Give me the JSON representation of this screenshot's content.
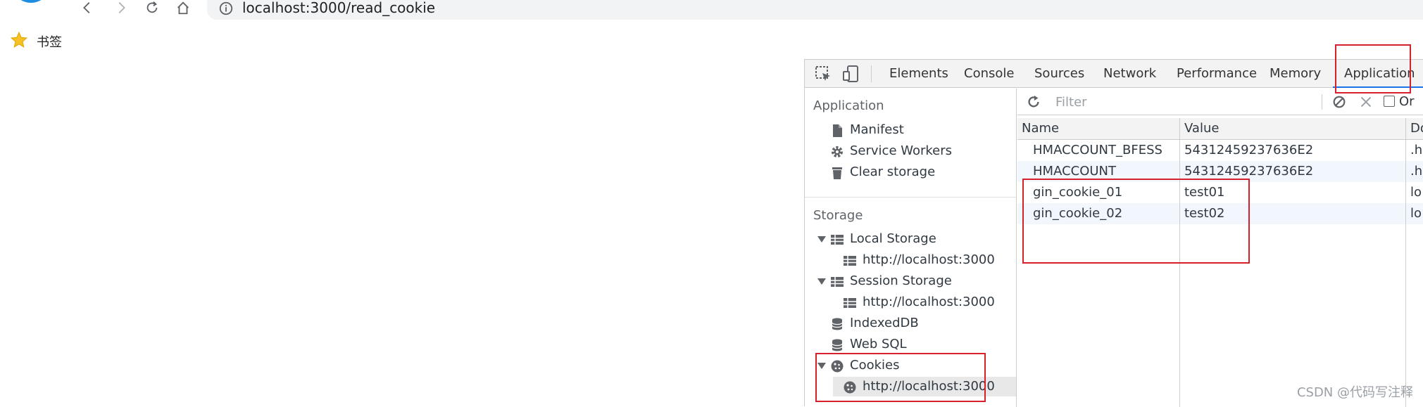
{
  "browser": {
    "url": "localhost:3000/read_cookie",
    "bookmark_label": "书签"
  },
  "devtools": {
    "tabs": [
      "Elements",
      "Console",
      "Sources",
      "Network",
      "Performance",
      "Memory",
      "Application"
    ],
    "active_tab": "Application",
    "sidebar": {
      "application_title": "Application",
      "application_items": [
        "Manifest",
        "Service Workers",
        "Clear storage"
      ],
      "storage_title": "Storage",
      "local_storage": {
        "label": "Local Storage",
        "child": "http://localhost:3000"
      },
      "session_storage": {
        "label": "Session Storage",
        "child": "http://localhost:3000"
      },
      "indexeddb": "IndexedDB",
      "websql": "Web SQL",
      "cookies": {
        "label": "Cookies",
        "child": "http://localhost:3000"
      }
    },
    "filter": {
      "placeholder": "Filter",
      "checkbox_label": "Or"
    },
    "table": {
      "columns": [
        "Name",
        "Value",
        "Do"
      ],
      "rows": [
        {
          "name": "HMACCOUNT_BFESS",
          "value": "54312459237636E2",
          "domain": ".h"
        },
        {
          "name": "HMACCOUNT",
          "value": "54312459237636E2",
          "domain": ".h"
        },
        {
          "name": "gin_cookie_01",
          "value": "test01",
          "domain": "lo"
        },
        {
          "name": "gin_cookie_02",
          "value": "test02",
          "domain": "lo"
        }
      ]
    }
  },
  "watermark": "CSDN @代码写注释",
  "colors": {
    "highlight": "#d6202b",
    "active_tab_underline": "#1a73e8",
    "alt_row": "#f2f7fd"
  }
}
